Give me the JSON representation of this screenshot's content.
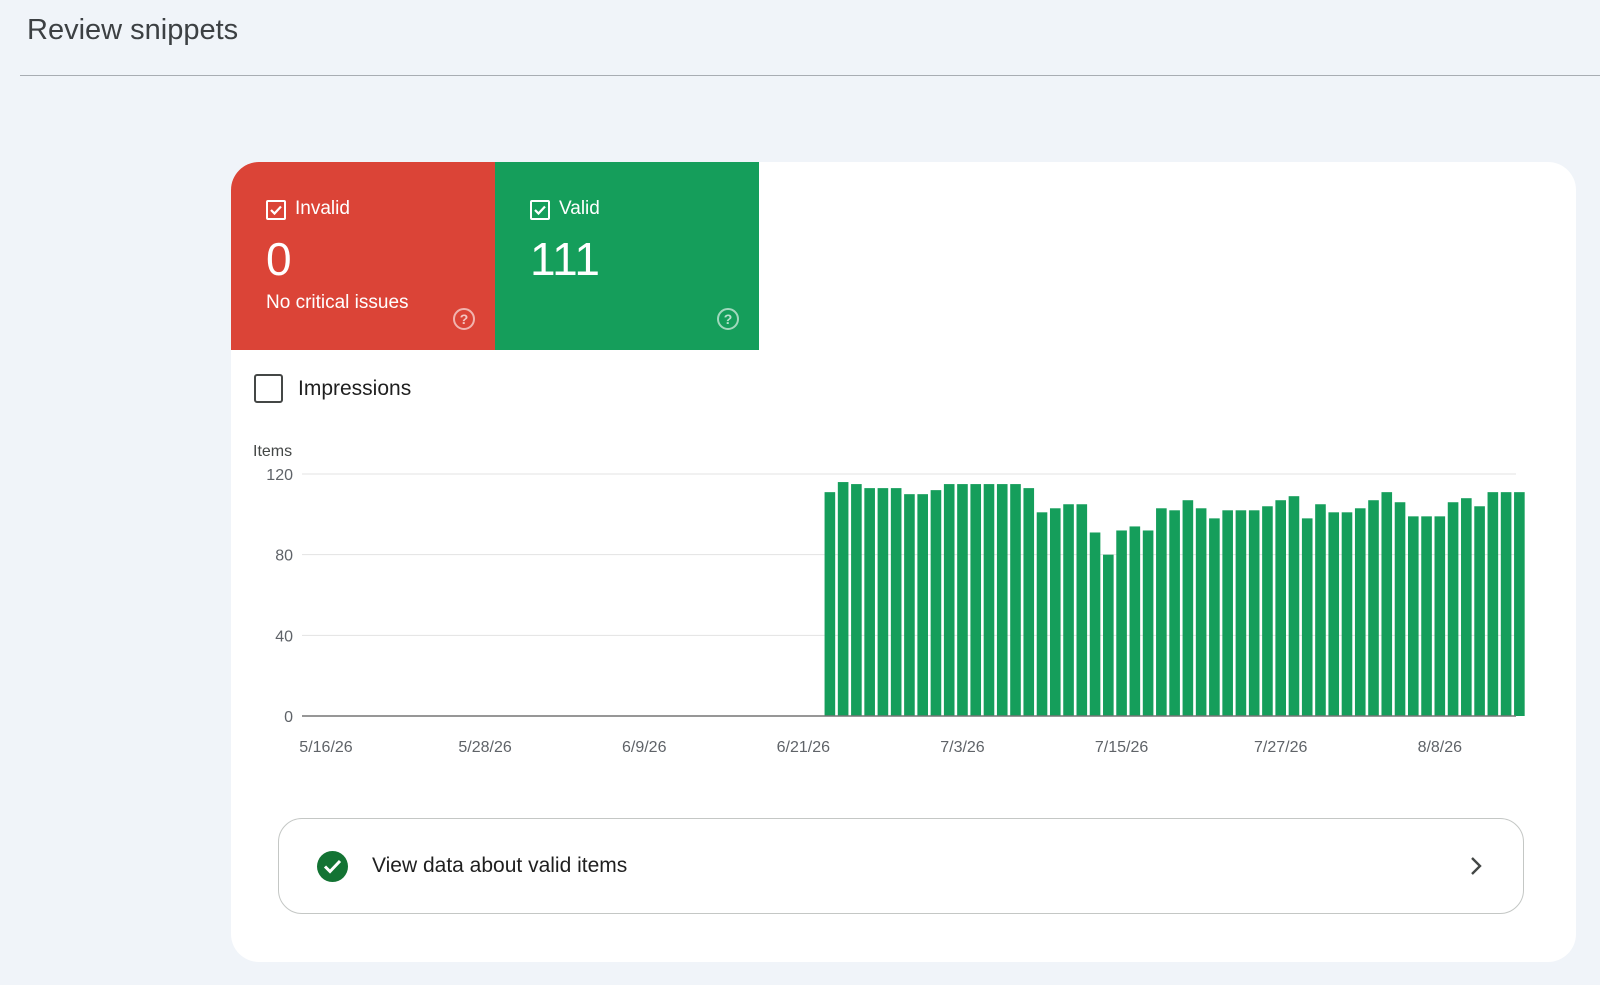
{
  "page": {
    "title": "Review snippets"
  },
  "tiles": {
    "invalid": {
      "label": "Invalid",
      "count": "0",
      "subtitle": "No critical issues",
      "color": "#db4437",
      "help_icon": "help-circle-icon"
    },
    "valid": {
      "label": "Valid",
      "count": "111",
      "color": "#159e5b",
      "help_icon": "help-circle-icon"
    }
  },
  "impressions": {
    "label": "Impressions",
    "checked": false
  },
  "chart_data": {
    "type": "bar",
    "ylabel": "Items",
    "ylim": [
      0,
      120
    ],
    "yticks": [
      "0",
      "40",
      "80",
      "120"
    ],
    "xtick_labels": [
      "5/16/26",
      "5/28/26",
      "6/9/26",
      "6/21/26",
      "7/3/26",
      "7/15/26",
      "7/27/26",
      "8/8/26"
    ],
    "x_start": "5/16/26",
    "x_end": "8/14/26",
    "bar_color": "#159e5b",
    "series": [
      {
        "first_bar_date": "6/23/26",
        "values": [
          111,
          116,
          115,
          113,
          113,
          113,
          110,
          110,
          112,
          115,
          115,
          115,
          115,
          115,
          115,
          113,
          101,
          103,
          105,
          105,
          91,
          80,
          92,
          94,
          92,
          103,
          102,
          107,
          103,
          98,
          102,
          102,
          102,
          104,
          107,
          109,
          98,
          105,
          101,
          101,
          103,
          107,
          111,
          106,
          99,
          99,
          99,
          106,
          108,
          104,
          111,
          111,
          111
        ]
      }
    ],
    "grid": true
  },
  "cta": {
    "label": "View data about valid items",
    "icon": "check-circle-icon",
    "chevron": "chevron-right-icon"
  }
}
